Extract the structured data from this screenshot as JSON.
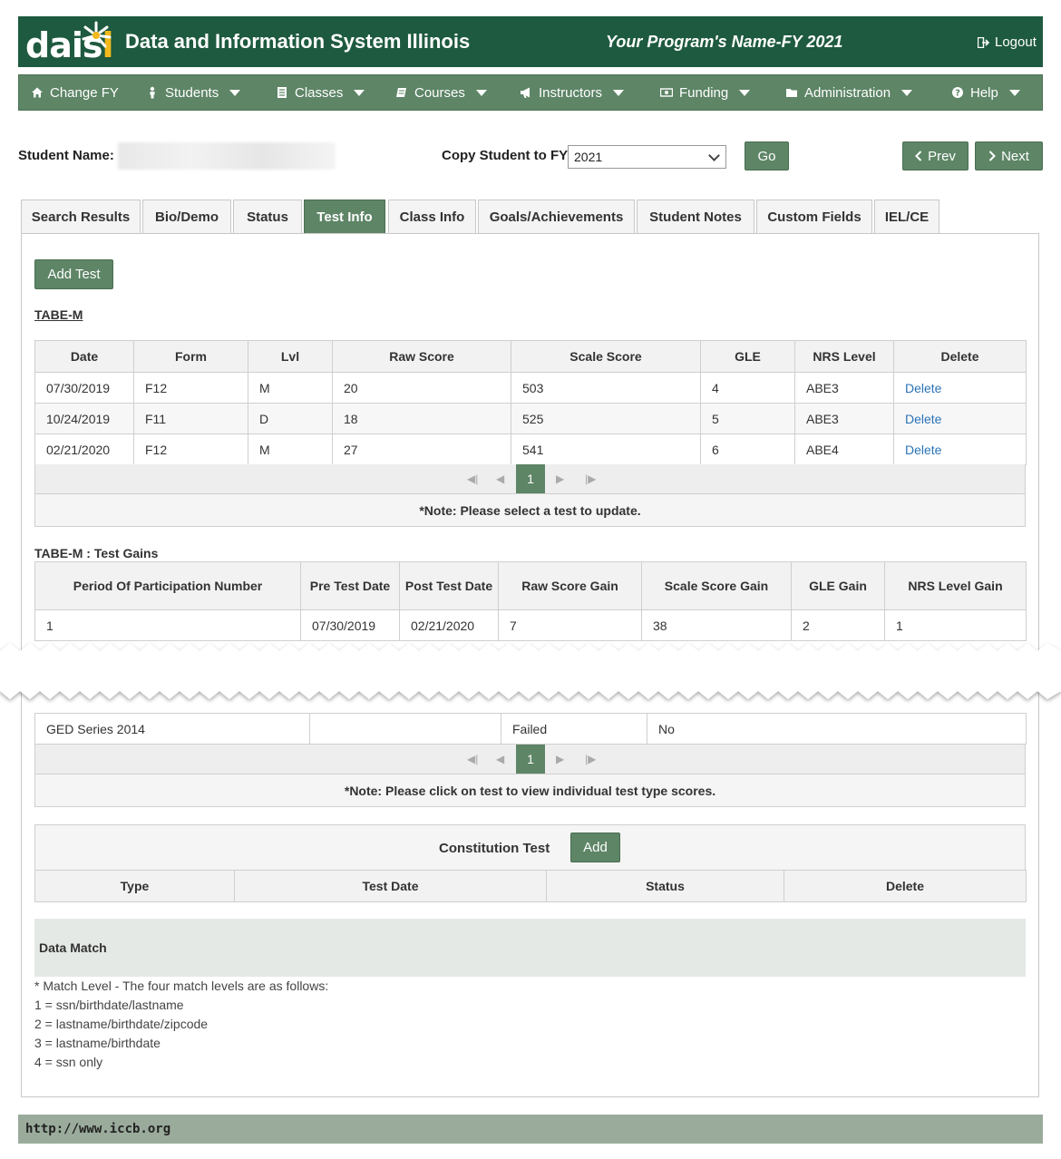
{
  "header": {
    "logo_text": "dais",
    "logo_i": "i",
    "app_title": "Data and Information System Illinois",
    "program_name": "Your Program's Name-FY 2021",
    "logout_label": "Logout"
  },
  "nav": {
    "items": [
      {
        "label": "Change FY",
        "icon": "home-icon",
        "has_dropdown": false
      },
      {
        "label": "Students",
        "icon": "student-icon",
        "has_dropdown": true
      },
      {
        "label": "Classes",
        "icon": "classes-icon",
        "has_dropdown": true
      },
      {
        "label": "Courses",
        "icon": "book-icon",
        "has_dropdown": true
      },
      {
        "label": "Instructors",
        "icon": "megaphone-icon",
        "has_dropdown": true
      },
      {
        "label": "Funding",
        "icon": "money-icon",
        "has_dropdown": true
      },
      {
        "label": "Administration",
        "icon": "folder-icon",
        "has_dropdown": true
      },
      {
        "label": "Help",
        "icon": "help-icon",
        "has_dropdown": true
      }
    ]
  },
  "student": {
    "name_label": "Student Name:",
    "copy_label": "Copy Student to FY:",
    "fy_selected": "2021",
    "go_label": "Go",
    "prev_label": "Prev",
    "next_label": "Next"
  },
  "tabs": [
    {
      "label": "Search Results",
      "active": false
    },
    {
      "label": "Bio/Demo",
      "active": false
    },
    {
      "label": "Status",
      "active": false
    },
    {
      "label": "Test Info",
      "active": true
    },
    {
      "label": "Class Info",
      "active": false
    },
    {
      "label": "Goals/Achievements",
      "active": false
    },
    {
      "label": "Student Notes",
      "active": false
    },
    {
      "label": "Custom Fields",
      "active": false
    },
    {
      "label": "IEL/CE",
      "active": false
    }
  ],
  "tabe": {
    "add_test_label": "Add Test",
    "title": "TABE-M",
    "columns": [
      "Date",
      "Form",
      "Lvl",
      "Raw Score",
      "Scale Score",
      "GLE",
      "NRS Level",
      "Delete"
    ],
    "rows": [
      [
        "07/30/2019",
        "F12",
        "M",
        "20",
        "503",
        "4",
        "ABE3",
        "Delete"
      ],
      [
        "10/24/2019",
        "F11",
        "D",
        "18",
        "525",
        "5",
        "ABE3",
        "Delete"
      ],
      [
        "02/21/2020",
        "F12",
        "M",
        "27",
        "541",
        "6",
        "ABE4",
        "Delete"
      ]
    ],
    "page": "1",
    "note": "*Note: Please select a test to update."
  },
  "gains": {
    "title": "TABE-M : Test Gains",
    "columns": [
      "Period Of Participation Number",
      "Pre Test Date",
      "Post Test Date",
      "Raw Score Gain",
      "Scale Score Gain",
      "GLE Gain",
      "NRS Level Gain"
    ],
    "rows": [
      [
        "1",
        "07/30/2019",
        "02/21/2020",
        "7",
        "38",
        "2",
        "1"
      ]
    ]
  },
  "ged": {
    "rows": [
      [
        "GED Series 2014",
        "",
        "Failed",
        "No"
      ]
    ],
    "page": "1",
    "note": "*Note: Please click on test to view individual test type scores."
  },
  "constitution": {
    "label": "Constitution Test",
    "add_label": "Add",
    "columns": [
      "Type",
      "Test Date",
      "Status",
      "Delete"
    ]
  },
  "data_match": {
    "title": "Data Match",
    "lines": [
      "* Match Level - The four match levels are as follows:",
      "1 = ssn/birthdate/lastname",
      "2 = lastname/birthdate/zipcode",
      "3 = lastname/birthdate",
      "4 = ssn only"
    ]
  },
  "footer": {
    "link": "http://www.iccb.org"
  },
  "colors": {
    "header_bg": "#1e5a3f",
    "nav_bg": "#5d8566",
    "accent_green": "#5d8566",
    "link_blue": "#2a73b8",
    "footer_bg": "#9aab9c"
  }
}
